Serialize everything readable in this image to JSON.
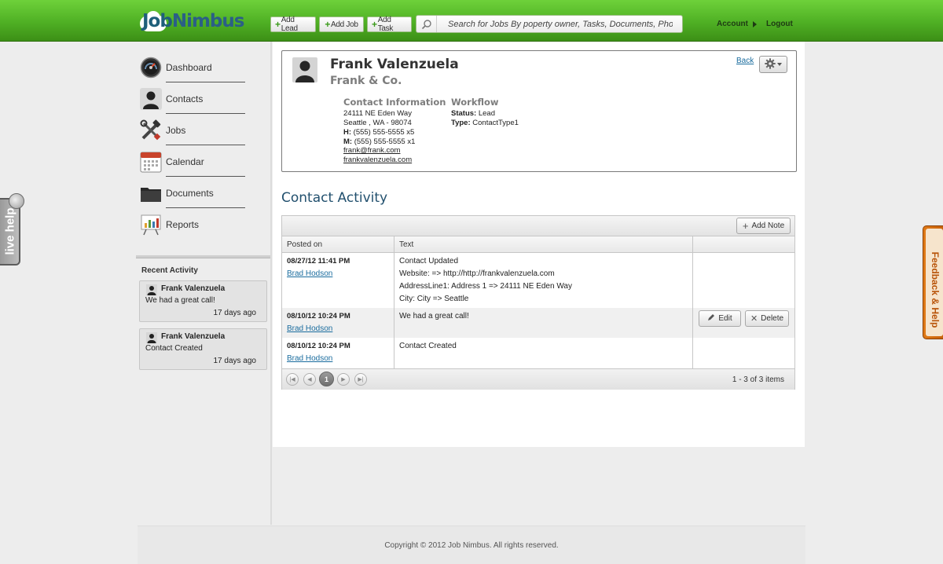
{
  "brand": {
    "part1": "Job",
    "part2": "Nimbus"
  },
  "toolbar": {
    "add_lead": "Add Lead",
    "add_job": "Add Job",
    "add_task": "Add Task",
    "search_placeholder": "Search for Jobs By poperty owner, Tasks, Documents, Photos",
    "account": "Account",
    "logout": "Logout"
  },
  "sidebar": {
    "items": [
      {
        "label": "Dashboard",
        "icon": "dashboard-gauge-icon"
      },
      {
        "label": "Contacts",
        "icon": "person-icon"
      },
      {
        "label": "Jobs",
        "icon": "tools-icon"
      },
      {
        "label": "Calendar",
        "icon": "calendar-icon"
      },
      {
        "label": "Documents",
        "icon": "folder-icon"
      },
      {
        "label": "Reports",
        "icon": "chart-icon"
      }
    ],
    "recent_title": "Recent Activity",
    "recent": [
      {
        "name": "Frank Valenzuela",
        "message": "We had a great call!",
        "ago": "17 days ago"
      },
      {
        "name": "Frank Valenzuela",
        "message": "Contact Created",
        "ago": "17 days ago"
      }
    ]
  },
  "contact": {
    "name": "Frank Valenzuela",
    "company": "Frank & Co.",
    "back": "Back",
    "info_title": "Contact Information",
    "address1": "24111 NE Eden Way",
    "address2": "Seattle , WA - 98074",
    "home_label": "H:",
    "home": "(555) 555-5555 x5",
    "mobile_label": "M:",
    "mobile": "(555) 555-5555 x1",
    "email": "frank@frank.com",
    "website": "frankvalenzuela.com",
    "workflow_title": "Workflow",
    "status_label": "Status:",
    "status": "Lead",
    "type_label": "Type:",
    "type": "ContactType1"
  },
  "activity": {
    "title": "Contact Activity",
    "add_note": "Add Note",
    "columns": [
      "Posted on",
      "Text",
      ""
    ],
    "rows": [
      {
        "date": "08/27/12 11:41 PM",
        "user": "Brad Hodson",
        "lines": [
          "Contact Updated",
          "Website: => http://http://frankvalenzuela.com",
          "AddressLine1: Address 1 => 24111 NE Eden Way",
          "City: City => Seattle"
        ]
      },
      {
        "date": "08/10/12 10:24 PM",
        "user": "Brad Hodson",
        "lines": [
          "We had a great call!"
        ]
      },
      {
        "date": "08/10/12 10:24 PM",
        "user": "Brad Hodson",
        "lines": [
          "Contact Created"
        ]
      }
    ],
    "edit": "Edit",
    "delete": "Delete",
    "page": "1",
    "pager_info": "1 - 3 of 3 items"
  },
  "footer": {
    "copyright": "Copyright © 2012 Job Nimbus. All rights reserved."
  },
  "tabs": {
    "live_help": "live help",
    "feedback": "Feedback & Help"
  },
  "colors": {
    "topbar": "#4fb024",
    "link": "#1a6c9e",
    "title": "#22506e",
    "feedback": "#d46c10"
  }
}
